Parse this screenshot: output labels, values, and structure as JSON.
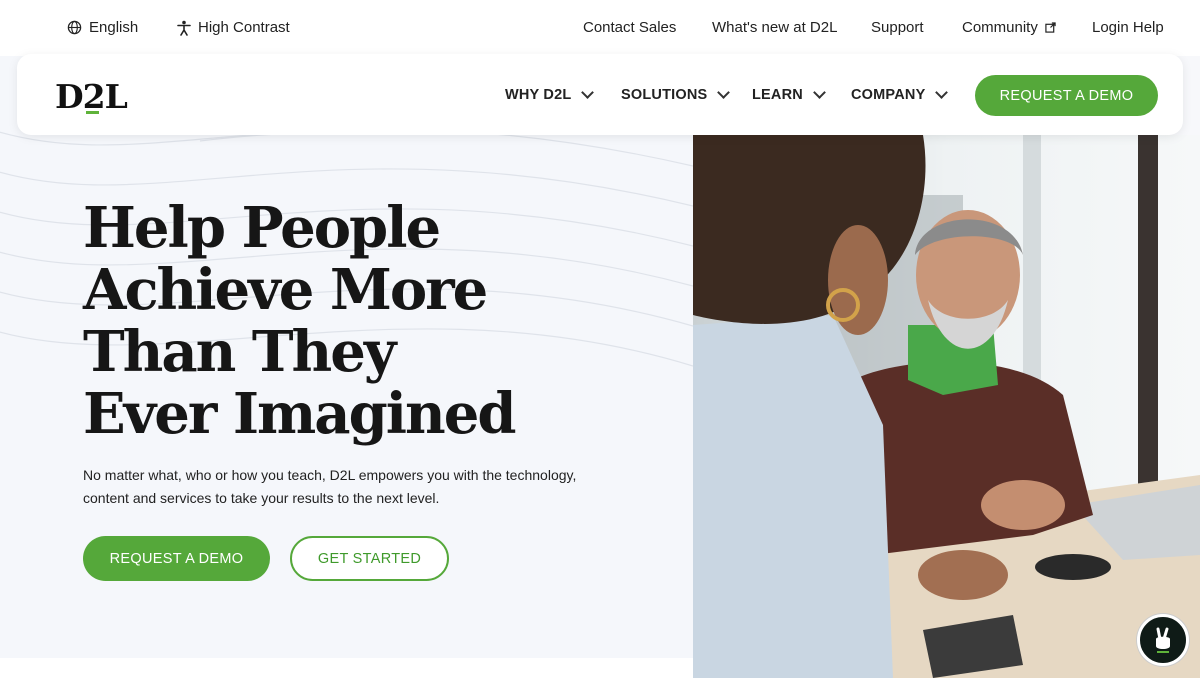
{
  "utility_bar": {
    "language": {
      "label": "English",
      "icon": "globe-icon"
    },
    "contrast": {
      "label": "High Contrast",
      "icon": "accessibility-icon"
    },
    "links": [
      {
        "label": "Contact Sales"
      },
      {
        "label": "What's new at D2L"
      },
      {
        "label": "Support"
      },
      {
        "label": "Community",
        "icon": "external-link-icon"
      },
      {
        "label": "Login Help"
      }
    ]
  },
  "nav": {
    "logo": "D2L",
    "items": [
      {
        "label": "WHY D2L"
      },
      {
        "label": "SOLUTIONS"
      },
      {
        "label": "LEARN"
      },
      {
        "label": "COMPANY"
      }
    ],
    "cta": "REQUEST A DEMO"
  },
  "hero": {
    "headline_lines": [
      "Help People",
      "Achieve More",
      "Than They",
      "Ever Imagined"
    ],
    "subtext_lines": [
      "No matter what, who or how you teach, D2L empowers you with the technology,",
      "content and services to take your results to the next level."
    ],
    "primary_cta": "REQUEST A DEMO",
    "secondary_cta": "GET STARTED"
  },
  "help_widget": {
    "icon": "peace-hand-icon"
  },
  "colors": {
    "brand_green": "#55a83a",
    "text_dark": "#161616",
    "hero_bg": "#f5f7fb"
  }
}
